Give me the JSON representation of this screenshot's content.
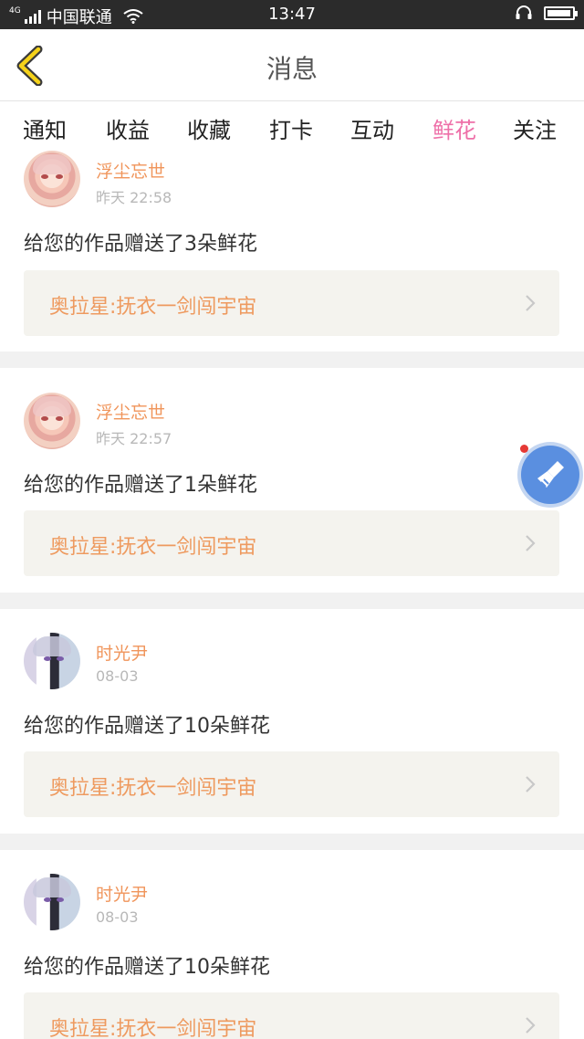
{
  "status_bar": {
    "network_tag": "4G",
    "carrier": "中国联通",
    "time": "13:47",
    "battery_level": 0.95
  },
  "header": {
    "title": "消息",
    "accent": "#f5d21a"
  },
  "tabs": [
    {
      "label": "通知",
      "active": false
    },
    {
      "label": "收益",
      "active": false
    },
    {
      "label": "收藏",
      "active": false
    },
    {
      "label": "打卡",
      "active": false
    },
    {
      "label": "互动",
      "active": false
    },
    {
      "label": "鲜花",
      "active": true
    },
    {
      "label": "关注",
      "active": false
    }
  ],
  "messages": [
    {
      "user": "浮尘忘世",
      "time": "昨天 22:58",
      "text": "给您的作品赠送了3朵鲜花",
      "work": "奥拉星:抚衣一剑闯宇宙"
    },
    {
      "user": "浮尘忘世",
      "time": "昨天 22:57",
      "text": "给您的作品赠送了1朵鲜花",
      "work": "奥拉星:抚衣一剑闯宇宙"
    },
    {
      "user": "时光尹",
      "time": "08-03",
      "text": "给您的作品赠送了10朵鲜花",
      "work": "奥拉星:抚衣一剑闯宇宙"
    },
    {
      "user": "时光尹",
      "time": "08-03",
      "text": "给您的作品赠送了10朵鲜花",
      "work": "奥拉星:抚衣一剑闯宇宙"
    }
  ],
  "colors": {
    "active_tab": "#ee6fa8",
    "username": "#f0955b",
    "work_title": "#ee9a5f",
    "link_bg": "#f4f3ee",
    "float_button": "#5a8fe0"
  },
  "icons": {
    "back": "chevron-left-icon",
    "link": "chevron-right-icon",
    "float": "broom-clean-icon",
    "wifi": "wifi-icon",
    "headset": "headset-icon",
    "battery": "battery-icon"
  }
}
